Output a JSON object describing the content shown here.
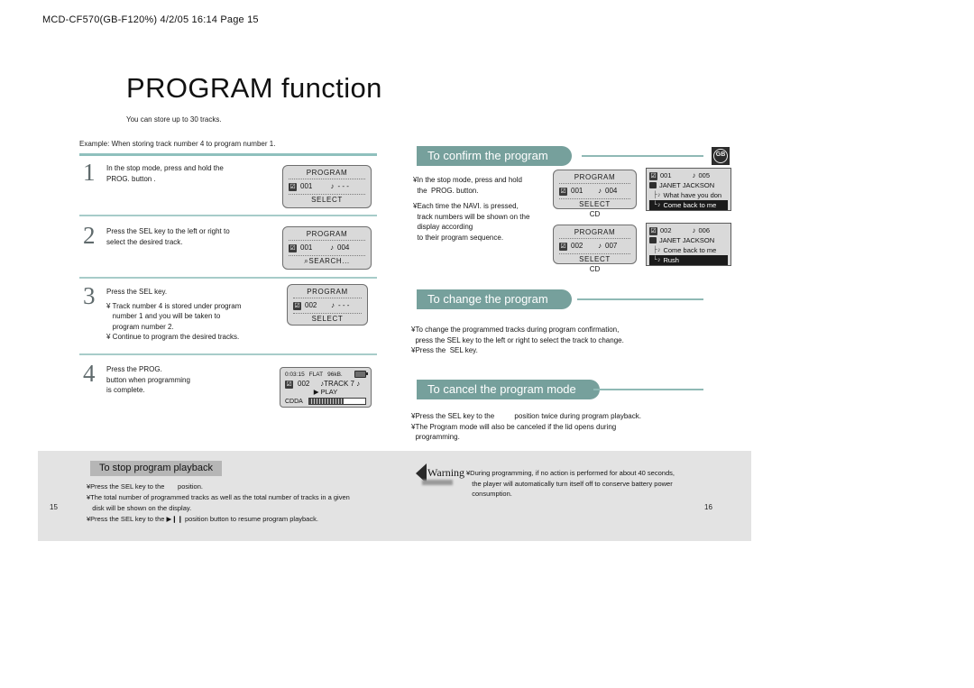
{
  "header": {
    "strip": "MCD-CF570(GB-F120%)  4/2/05 16:14  Page 15"
  },
  "title": "PROGRAM function",
  "subnote": "You can store up to 30 tracks.",
  "example_line": "Example: When storing track number 4 to program number 1.",
  "badge": {
    "label": "GB"
  },
  "steps": [
    {
      "num": "1",
      "lines": [
        "In the stop mode, press and hold the",
        "PROG. button ."
      ],
      "lcd": {
        "title": "PROGRAM",
        "prog": "001",
        "note": "♪",
        "track": "- - -",
        "bottom": "SELECT"
      }
    },
    {
      "num": "2",
      "lines": [
        "Press the SEL key to the left or right to",
        "select the desired track."
      ],
      "lcd": {
        "title": "PROGRAM",
        "prog": "001",
        "note": "♪",
        "track": "004",
        "bottom": "SEARCH..."
      }
    },
    {
      "num": "3",
      "lines": [
        "Press the SEL key.",
        "¥ Track number 4 is stored under program",
        "   number 1 and you will be taken to",
        "   program number 2.",
        "¥ Continue to program the desired tracks."
      ],
      "lcd": {
        "title": "PROGRAM",
        "prog": "002",
        "note": "♪",
        "track": "- - -",
        "bottom": "SELECT"
      }
    },
    {
      "num": "4",
      "lines": [
        "Press the PROG.",
        "button when programming",
        "is complete."
      ],
      "lcd4": {
        "time": "0:03:15",
        "eq": "FLAT",
        "rate": "96kB.",
        "prog": "002",
        "track": "♪TRACK 7 ♪",
        "state": "▶ PLAY",
        "format": "CDDA"
      }
    }
  ],
  "sections": [
    {
      "heading": "To confirm the program",
      "lines": [
        "¥In the stop mode, press and hold",
        "  the  PROG. button.",
        "",
        "¥Each time the NAVI. is pressed,",
        "  track numbers will be shown on the",
        "  display according",
        "  to their program sequence."
      ]
    },
    {
      "heading": "To change the program",
      "lines": [
        "¥To change the programmed tracks during program confirmation,",
        "  press the SEL key to the left or right to select the track to change.",
        "¥Press the  SEL key."
      ]
    },
    {
      "heading": "To cancel the program mode",
      "lines": [
        "¥Press the SEL key to the          position twice during program playback.",
        "¥The Program mode will also be canceled if the lid opens during",
        "  programming."
      ]
    }
  ],
  "confirm_displays": [
    {
      "lcd": {
        "title": "PROGRAM",
        "prog": "001",
        "note": "♪",
        "track": "004",
        "bottom": "SELECT"
      },
      "caption": "CD",
      "nav": {
        "header_prog": "001",
        "header_note": "♪",
        "header_track": "005",
        "artist": "JANET JACKSON",
        "tracks": [
          "What have you don",
          "Come back to me"
        ],
        "highlight_index": 1
      }
    },
    {
      "lcd": {
        "title": "PROGRAM",
        "prog": "002",
        "note": "♪",
        "track": "007",
        "bottom": "SELECT"
      },
      "caption": "CD",
      "nav": {
        "header_prog": "002",
        "header_note": "♪",
        "header_track": "006",
        "artist": "JANET JACKSON",
        "tracks": [
          "Come back to me",
          "Rush"
        ],
        "highlight_index": 1
      }
    }
  ],
  "stop_section": {
    "heading": "To stop program playback",
    "lines": [
      "¥Press the SEL key to the       position.",
      "¥The total number of programmed tracks as well as the total number of tracks in a given",
      "   disk will be shown on the display.",
      "¥Press the SEL key to the ▶❙❙ position button to resume program playback."
    ]
  },
  "warning": {
    "label": "Warning",
    "lines": [
      "¥During programming, if no action is performed for about 40 seconds,",
      "   the player will automatically turn itself off to conserve battery power",
      "   consumption."
    ]
  },
  "page_numbers": {
    "left": "15",
    "right": "16"
  },
  "colors": {
    "teal": "#76a09c",
    "rule": "#8fc0bd",
    "band": "#e3e3e3",
    "lcd": "#d9d9d9"
  }
}
